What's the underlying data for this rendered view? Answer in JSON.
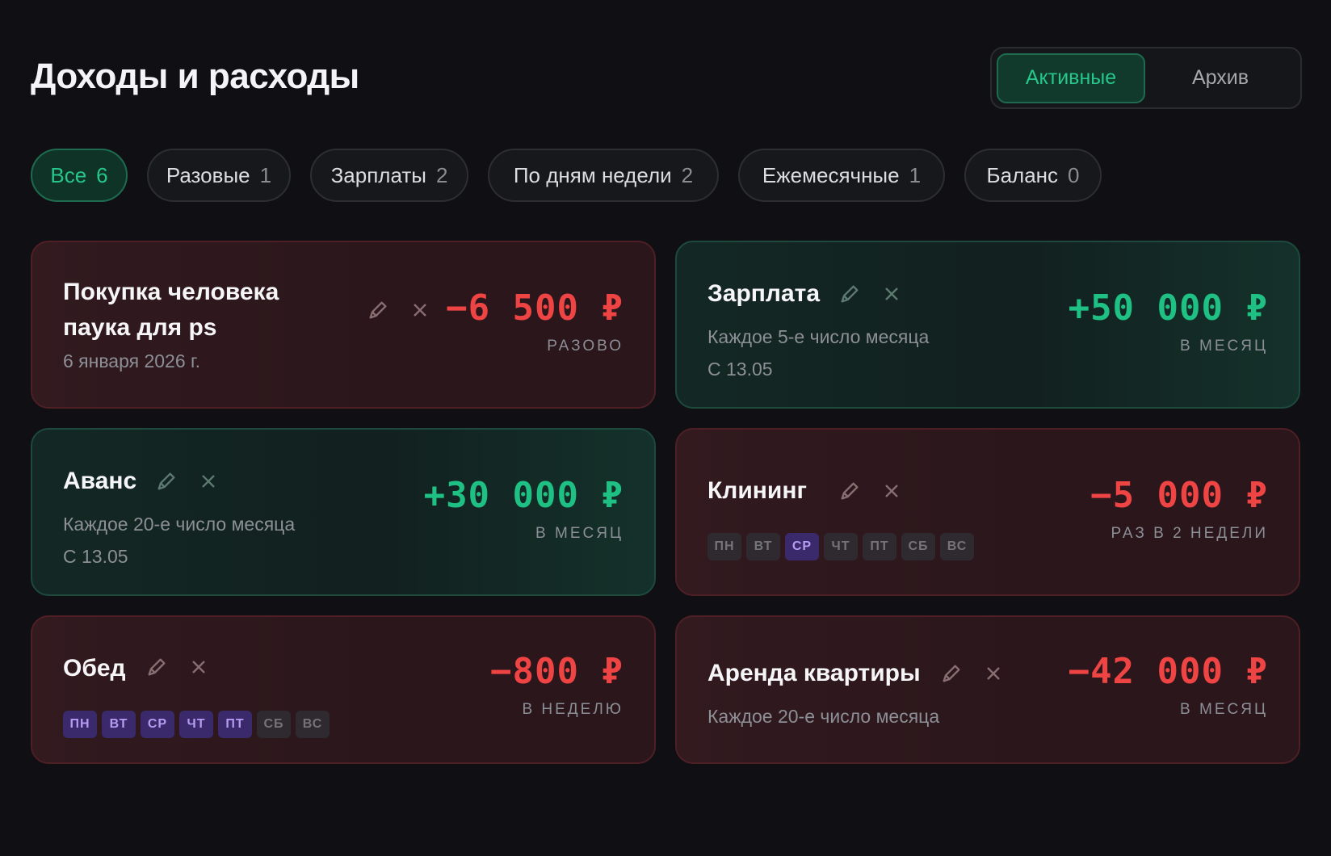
{
  "header": {
    "title": "Доходы и расходы",
    "modes": [
      {
        "label": "Активные",
        "active": true
      },
      {
        "label": "Архив",
        "active": false
      }
    ]
  },
  "filters": [
    {
      "label": "Все",
      "count": "6",
      "active": true
    },
    {
      "label": "Разовые",
      "count": "1",
      "active": false
    },
    {
      "label": "Зарплаты",
      "count": "2",
      "active": false
    },
    {
      "label": "По дням недели",
      "count": "2",
      "active": false
    },
    {
      "label": "Ежемесячные",
      "count": "1",
      "active": false
    },
    {
      "label": "Баланс",
      "count": "0",
      "active": false
    }
  ],
  "icons": {
    "edit": "pencil-icon",
    "delete": "close-icon"
  },
  "colors": {
    "income": "#1fc084",
    "expense": "#ef4444",
    "accent": "#27c68b",
    "day_active": "#b59cf2"
  },
  "cards": [
    {
      "title": "Покупка человека паука для ps",
      "subtitle": "6 января 2026 г.",
      "amount": "−6 500 ₽",
      "frequency": "РАЗОВО",
      "kind": "expense"
    },
    {
      "title": "Зарплата",
      "subtitle": "Каждое 5-е число месяца",
      "since": "С 13.05",
      "amount": "+50 000 ₽",
      "frequency": "В МЕСЯЦ",
      "kind": "income"
    },
    {
      "title": "Аванс",
      "subtitle": "Каждое 20-е число месяца",
      "since": "С 13.05",
      "amount": "+30 000 ₽",
      "frequency": "В МЕСЯЦ",
      "kind": "income"
    },
    {
      "title": "Клининг",
      "amount": "−5 000 ₽",
      "frequency": "РАЗ В 2 НЕДЕЛИ",
      "kind": "expense",
      "days": [
        {
          "label": "ПН",
          "on": false
        },
        {
          "label": "ВТ",
          "on": false
        },
        {
          "label": "СР",
          "on": true
        },
        {
          "label": "ЧТ",
          "on": false
        },
        {
          "label": "ПТ",
          "on": false
        },
        {
          "label": "СБ",
          "on": false
        },
        {
          "label": "ВС",
          "on": false
        }
      ]
    },
    {
      "title": "Обед",
      "amount": "−800 ₽",
      "frequency": "В НЕДЕЛЮ",
      "kind": "expense",
      "days": [
        {
          "label": "ПН",
          "on": true
        },
        {
          "label": "ВТ",
          "on": true
        },
        {
          "label": "СР",
          "on": true
        },
        {
          "label": "ЧТ",
          "on": true
        },
        {
          "label": "ПТ",
          "on": true
        },
        {
          "label": "СБ",
          "on": false
        },
        {
          "label": "ВС",
          "on": false
        }
      ]
    },
    {
      "title": "Аренда квартиры",
      "subtitle": "Каждое 20-е число месяца",
      "amount": "−42 000 ₽",
      "frequency": "В МЕСЯЦ",
      "kind": "expense"
    }
  ]
}
